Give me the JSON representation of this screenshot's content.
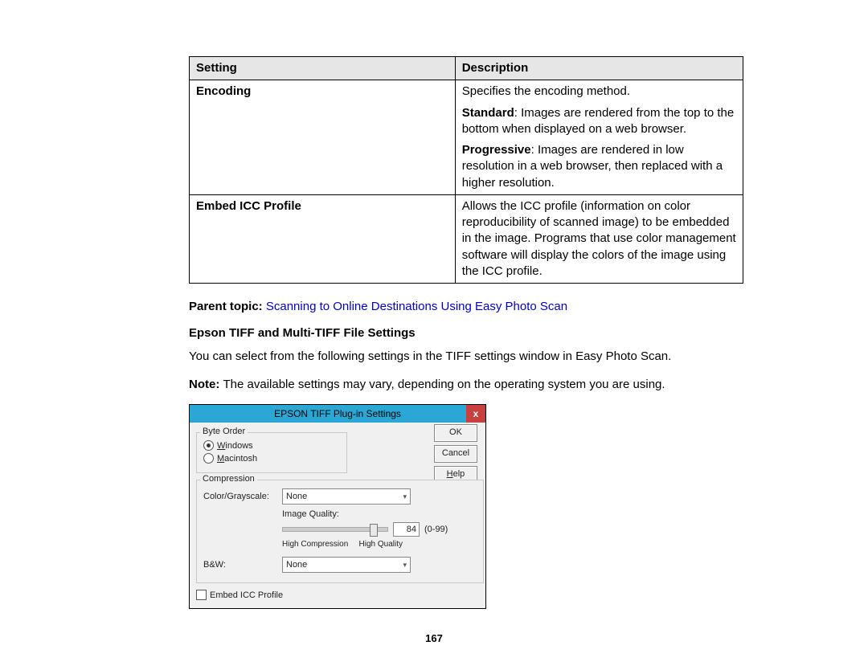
{
  "table": {
    "headers": {
      "setting": "Setting",
      "description": "Description"
    },
    "rows": [
      {
        "setting": "Encoding",
        "desc_p1": "Specifies the encoding method.",
        "desc_p2_b": "Standard",
        "desc_p2": ": Images are rendered from the top to the bottom when displayed on a web browser.",
        "desc_p3_b": "Progressive",
        "desc_p3": ": Images are rendered in low resolution in a web browser, then replaced with a higher resolution."
      },
      {
        "setting": "Embed ICC Profile",
        "desc": "Allows the ICC profile (information on color reproducibility of scanned image) to be embedded in the image. Programs that use color management software will display the colors of the image using the ICC profile."
      }
    ]
  },
  "parent_topic": {
    "label": "Parent topic: ",
    "link": "Scanning to Online Destinations Using Easy Photo Scan"
  },
  "section_heading": "Epson TIFF and Multi-TIFF File Settings",
  "intro_para": "You can select from the following settings in the TIFF settings window in Easy Photo Scan.",
  "note_label": "Note: ",
  "note_text": "The available settings may vary, depending on the operating system you are using.",
  "dialog": {
    "title": "EPSON TIFF Plug-in Settings",
    "close": "x",
    "byte_order_legend": "Byte Order",
    "radio_windows_u": "W",
    "radio_windows": "indows",
    "radio_mac_u": "M",
    "radio_mac": "acintosh",
    "buttons": {
      "ok": "OK",
      "cancel": "Cancel",
      "help_u": "H",
      "help": "elp"
    },
    "compression_legend": "Compression",
    "color_label": "Color/Grayscale:",
    "color_value": "None",
    "image_quality_label": "Image Quality:",
    "quality_value": "84",
    "quality_range": "(0-99)",
    "quality_low": "High Compression",
    "quality_high": "High Quality",
    "bw_label": "B&W:",
    "bw_value": "None",
    "embed_icc": "Embed ICC Profile"
  },
  "page_number": "167"
}
